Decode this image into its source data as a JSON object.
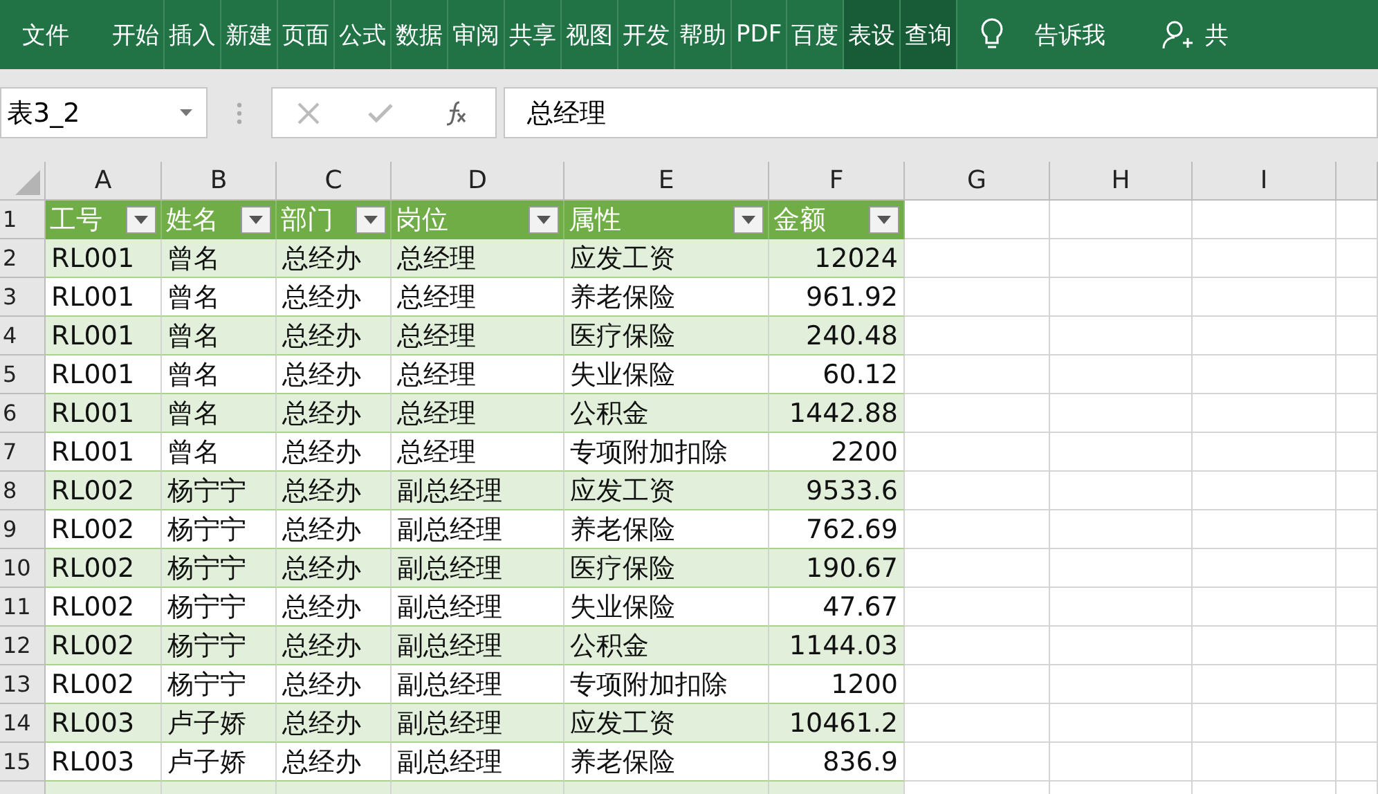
{
  "ribbon": {
    "tabs": [
      {
        "label": "文件",
        "highlighted": false
      },
      {
        "label": "开始",
        "highlighted": false
      },
      {
        "label": "插入",
        "highlighted": false
      },
      {
        "label": "新建",
        "highlighted": false
      },
      {
        "label": "页面",
        "highlighted": false
      },
      {
        "label": "公式",
        "highlighted": false
      },
      {
        "label": "数据",
        "highlighted": false
      },
      {
        "label": "审阅",
        "highlighted": false
      },
      {
        "label": "共享",
        "highlighted": false
      },
      {
        "label": "视图",
        "highlighted": false
      },
      {
        "label": "开发",
        "highlighted": false
      },
      {
        "label": "帮助",
        "highlighted": false
      },
      {
        "label": "PDF",
        "highlighted": false
      },
      {
        "label": "百度",
        "highlighted": false
      },
      {
        "label": "表设",
        "highlighted": true
      },
      {
        "label": "查询",
        "highlighted": true
      }
    ],
    "tell_me": "告诉我",
    "share": "共"
  },
  "name_box": "表3_2",
  "formula": "总经理",
  "column_letters": [
    "A",
    "B",
    "C",
    "D",
    "E",
    "F",
    "G",
    "H",
    "I"
  ],
  "row_numbers": [
    "1",
    "2",
    "3",
    "4",
    "5",
    "6",
    "7",
    "8",
    "9",
    "10",
    "11",
    "12",
    "13",
    "14",
    "15"
  ],
  "table": {
    "columns": [
      "工号",
      "姓名",
      "部门",
      "岗位",
      "属性",
      "金额"
    ],
    "rows": [
      [
        "RL001",
        "曾名",
        "总经办",
        "总经理",
        "应发工资",
        "12024"
      ],
      [
        "RL001",
        "曾名",
        "总经办",
        "总经理",
        "养老保险",
        "961.92"
      ],
      [
        "RL001",
        "曾名",
        "总经办",
        "总经理",
        "医疗保险",
        "240.48"
      ],
      [
        "RL001",
        "曾名",
        "总经办",
        "总经理",
        "失业保险",
        "60.12"
      ],
      [
        "RL001",
        "曾名",
        "总经办",
        "总经理",
        "公积金",
        "1442.88"
      ],
      [
        "RL001",
        "曾名",
        "总经办",
        "总经理",
        "专项附加扣除",
        "2200"
      ],
      [
        "RL002",
        "杨宁宁",
        "总经办",
        "副总经理",
        "应发工资",
        "9533.6"
      ],
      [
        "RL002",
        "杨宁宁",
        "总经办",
        "副总经理",
        "养老保险",
        "762.69"
      ],
      [
        "RL002",
        "杨宁宁",
        "总经办",
        "副总经理",
        "医疗保险",
        "190.67"
      ],
      [
        "RL002",
        "杨宁宁",
        "总经办",
        "副总经理",
        "失业保险",
        "47.67"
      ],
      [
        "RL002",
        "杨宁宁",
        "总经办",
        "副总经理",
        "公积金",
        "1144.03"
      ],
      [
        "RL002",
        "杨宁宁",
        "总经办",
        "副总经理",
        "专项附加扣除",
        "1200"
      ],
      [
        "RL003",
        "卢子娇",
        "总经办",
        "副总经理",
        "应发工资",
        "10461.2"
      ],
      [
        "RL003",
        "卢子娇",
        "总经办",
        "副总经理",
        "养老保险",
        "836.9"
      ]
    ]
  }
}
